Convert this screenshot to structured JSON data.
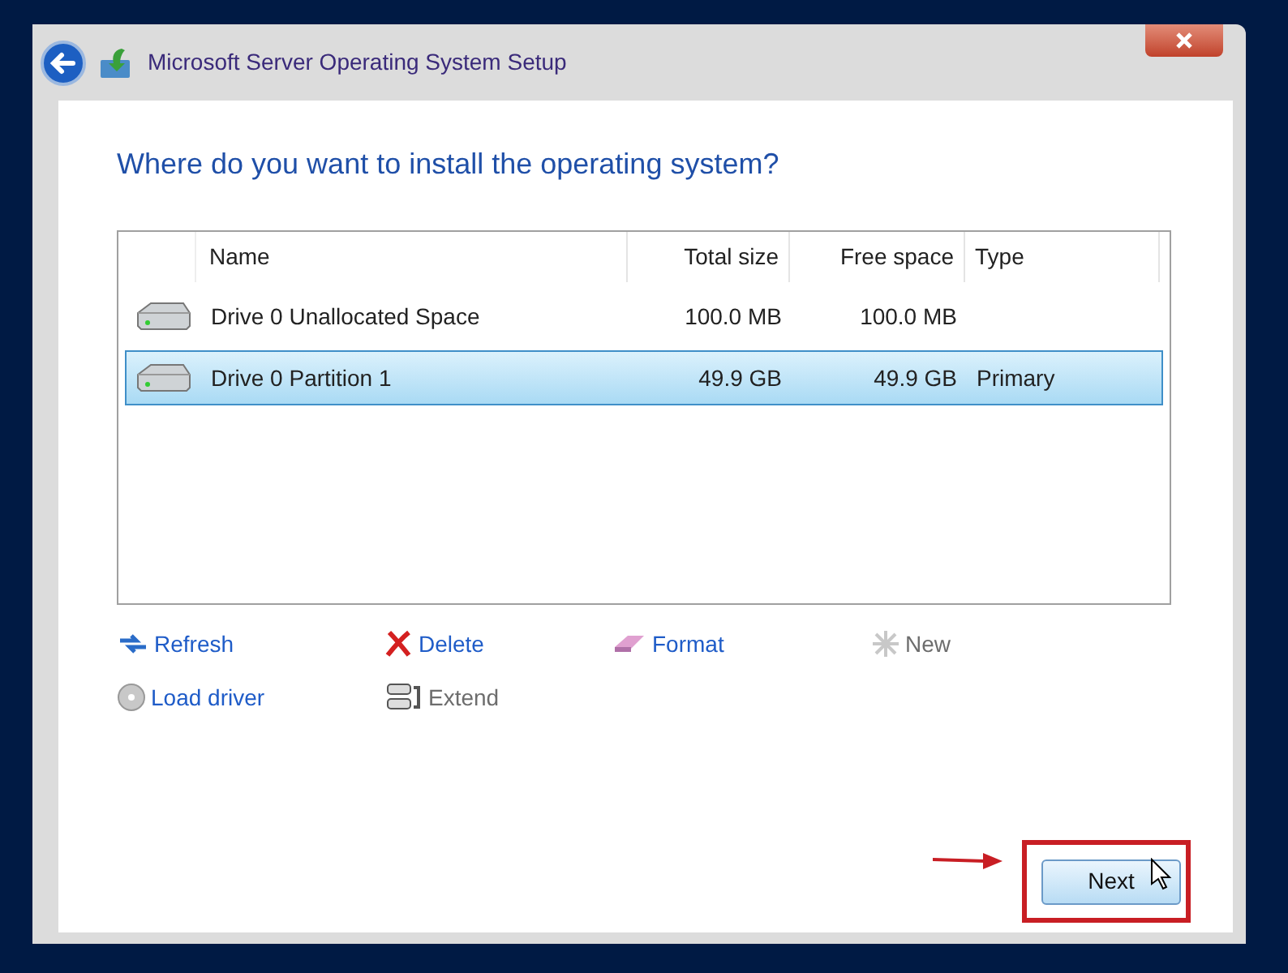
{
  "window": {
    "title": "Microsoft Server Operating System Setup"
  },
  "heading": "Where do you want to install the operating system?",
  "table": {
    "columns": [
      "Name",
      "Total size",
      "Free space",
      "Type"
    ],
    "rows": [
      {
        "name": "Drive 0 Unallocated Space",
        "total": "100.0 MB",
        "free": "100.0 MB",
        "selected": false
      },
      {
        "name": "Drive 0 Partition 1",
        "total": "49.9 GB",
        "free": "49.9 GB",
        "type": "Primary",
        "selected": true
      }
    ]
  },
  "actions": [
    {
      "kind": "refresh",
      "label": "Refresh",
      "disabled": false
    },
    {
      "kind": "delete",
      "label": "Delete",
      "disabled": false
    },
    {
      "kind": "format",
      "label": "Format",
      "disabled": false
    },
    {
      "kind": "new",
      "label": "New",
      "disabled": true
    },
    {
      "kind": "load",
      "label": "Load driver",
      "disabled": false
    },
    {
      "kind": "extend",
      "label": "Extend",
      "disabled": true
    }
  ],
  "next_button": "Next"
}
